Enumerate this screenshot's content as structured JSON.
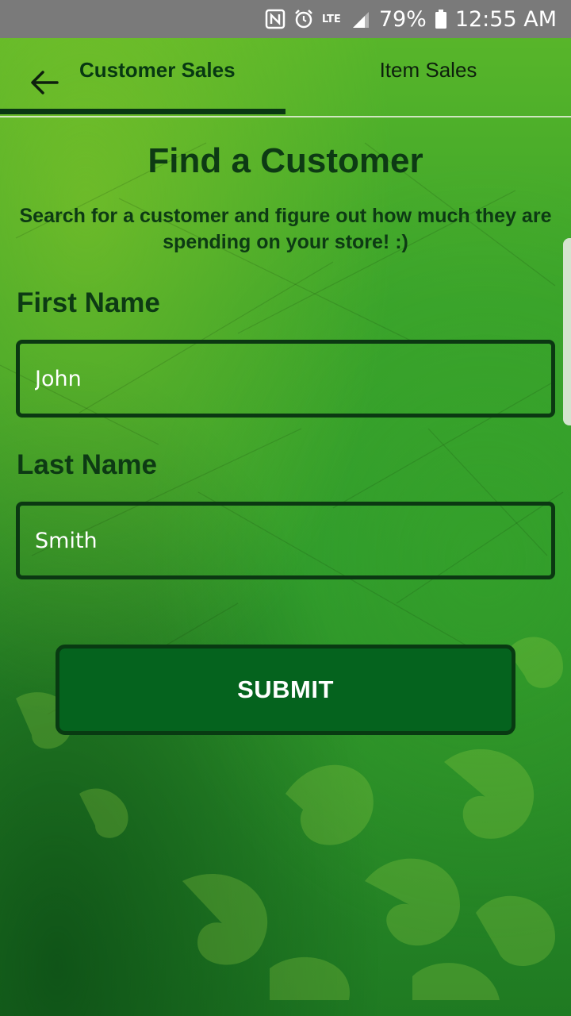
{
  "status_bar": {
    "network": "LTE",
    "battery_percent": "79%",
    "time": "12:55 AM"
  },
  "tabs": [
    {
      "label": "Customer Sales",
      "selected": true
    },
    {
      "label": "Item Sales",
      "selected": false
    }
  ],
  "main": {
    "title": "Find a Customer",
    "subtitle_line1": "Search for a customer and figure out how much they are",
    "subtitle_line2": "spending on your store! :)",
    "first_name_label": "First Name",
    "first_name_value": "John",
    "last_name_label": "Last Name",
    "last_name_value": "Smith",
    "submit_label": "SUBMIT"
  },
  "colors": {
    "accent_dark_green": "#0d3a14",
    "button_green": "#05631e",
    "background_green": "#3aa32b"
  }
}
